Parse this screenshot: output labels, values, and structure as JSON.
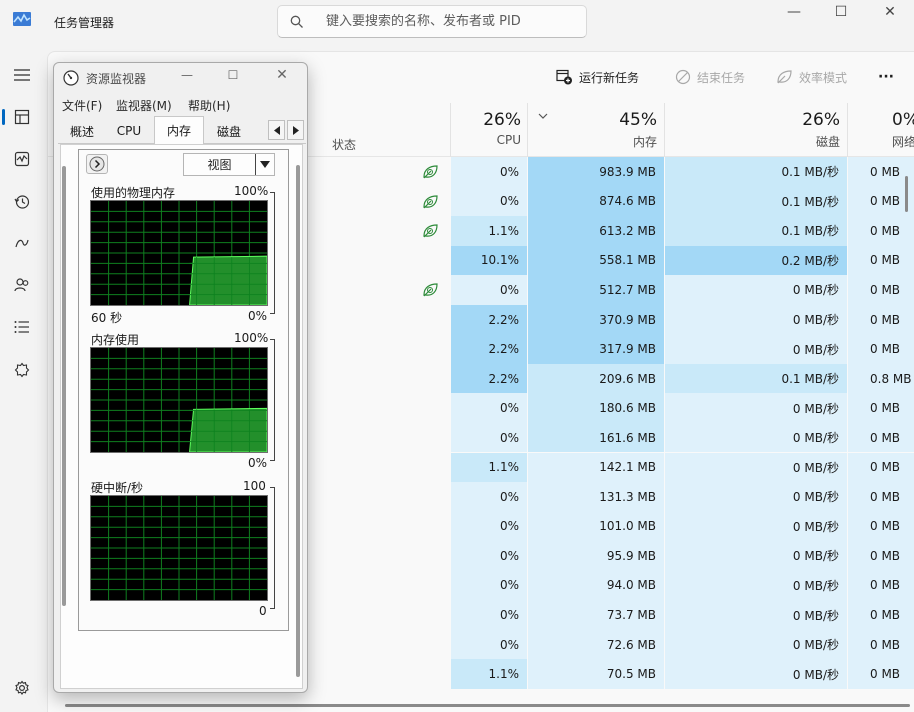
{
  "app": {
    "title": "任务管理器"
  },
  "search": {
    "placeholder": "键入要搜索的名称、发布者或 PID"
  },
  "window_controls": {
    "minimize": "—",
    "maximize": "☐",
    "close": "✕"
  },
  "toolbar": {
    "run_new_task": "运行新任务",
    "end_task": "结束任务",
    "efficiency_mode": "效率模式",
    "more": "···"
  },
  "table": {
    "status_label": "状态",
    "columns": [
      {
        "pct": "26%",
        "label": "CPU"
      },
      {
        "pct": "45%",
        "label": "内存"
      },
      {
        "pct": "26%",
        "label": "磁盘"
      },
      {
        "pct": "0%",
        "label": "网络"
      }
    ],
    "rows": [
      {
        "leaf": true,
        "cpu": "0%",
        "mem": "983.9 MB",
        "disk": "0.1 MB/秒",
        "net": "0 MB"
      },
      {
        "leaf": true,
        "cpu": "0%",
        "mem": "874.6 MB",
        "disk": "0.1 MB/秒",
        "net": "0 MB"
      },
      {
        "leaf": true,
        "cpu": "1.1%",
        "mem": "613.2 MB",
        "disk": "0.1 MB/秒",
        "net": "0 MB"
      },
      {
        "leaf": false,
        "cpu": "10.1%",
        "mem": "558.1 MB",
        "disk": "0.2 MB/秒",
        "net": "0 MB"
      },
      {
        "leaf": true,
        "cpu": "0%",
        "mem": "512.7 MB",
        "disk": "0 MB/秒",
        "net": "0 MB"
      },
      {
        "leaf": false,
        "cpu": "2.2%",
        "mem": "370.9 MB",
        "disk": "0 MB/秒",
        "net": "0 MB"
      },
      {
        "leaf": false,
        "cpu": "2.2%",
        "mem": "317.9 MB",
        "disk": "0 MB/秒",
        "net": "0 MB"
      },
      {
        "leaf": false,
        "cpu": "2.2%",
        "mem": "209.6 MB",
        "disk": "0.1 MB/秒",
        "net": "0.8 MB"
      },
      {
        "leaf": false,
        "cpu": "0%",
        "mem": "180.6 MB",
        "disk": "0 MB/秒",
        "net": "0 MB"
      },
      {
        "leaf": false,
        "cpu": "0%",
        "mem": "161.6 MB",
        "disk": "0 MB/秒",
        "net": "0 MB"
      },
      {
        "leaf": false,
        "cpu": "1.1%",
        "mem": "142.1 MB",
        "disk": "0 MB/秒",
        "net": "0 MB"
      },
      {
        "leaf": false,
        "cpu": "0%",
        "mem": "131.3 MB",
        "disk": "0 MB/秒",
        "net": "0 MB"
      },
      {
        "leaf": false,
        "cpu": "0%",
        "mem": "101.0 MB",
        "disk": "0 MB/秒",
        "net": "0 MB"
      },
      {
        "leaf": false,
        "cpu": "0%",
        "mem": "95.9 MB",
        "disk": "0 MB/秒",
        "net": "0 MB"
      },
      {
        "leaf": false,
        "cpu": "0%",
        "mem": "94.0 MB",
        "disk": "0 MB/秒",
        "net": "0 MB"
      },
      {
        "leaf": false,
        "cpu": "0%",
        "mem": "73.7 MB",
        "disk": "0 MB/秒",
        "net": "0 MB"
      },
      {
        "leaf": false,
        "cpu": "0%",
        "mem": "72.6 MB",
        "disk": "0 MB/秒",
        "net": "0 MB"
      },
      {
        "leaf": false,
        "cpu": "1.1%",
        "mem": "70.5 MB",
        "disk": "0 MB/秒",
        "net": "0 MB"
      }
    ]
  },
  "colors": {
    "heat_light": "#dff1fb",
    "heat_mid": "#c9e9f9",
    "heat_strong": "#a3d8f6",
    "accent": "#0067c0",
    "graph_green": "#2fbf3a"
  },
  "resmon": {
    "title": "资源监视器",
    "menus": [
      "文件(F)",
      "监视器(M)",
      "帮助(H)"
    ],
    "tabs": [
      "概述",
      "CPU",
      "内存",
      "磁盘"
    ],
    "active_tab": "内存",
    "view_button": "视图",
    "graphs": [
      {
        "label": "使用的物理内存",
        "max": "100%",
        "left_bottom": "60 秒",
        "min": "0%",
        "level": 0.46,
        "rise_at": 0.56
      },
      {
        "label": "内存使用",
        "max": "100%",
        "left_bottom": "",
        "min": "0%",
        "level": 0.41,
        "rise_at": 0.56
      },
      {
        "label": "硬中断/秒",
        "max": "100",
        "left_bottom": "",
        "min": "0",
        "level": 0,
        "rise_at": 1
      }
    ]
  }
}
